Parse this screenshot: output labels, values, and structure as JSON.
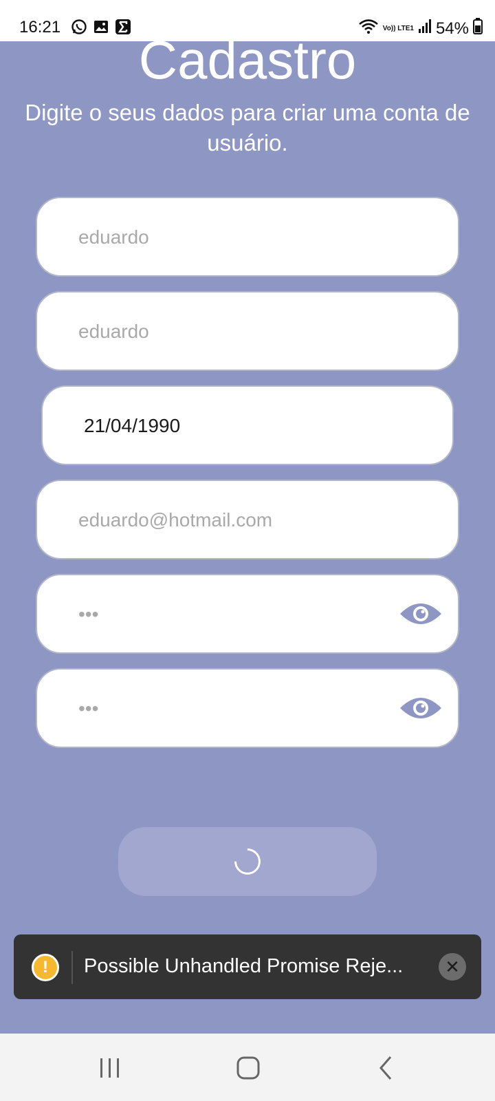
{
  "status_bar": {
    "time": "16:21",
    "left_icons": [
      "whatsapp-icon",
      "gallery-icon",
      "sigma-icon"
    ],
    "network": "Vo)) LTE1",
    "battery": "54%"
  },
  "page": {
    "title": "Cadastro",
    "subtitle": "Digite o seus dados para criar uma conta de usuário."
  },
  "form": {
    "first_name": {
      "placeholder": "eduardo"
    },
    "last_name": {
      "placeholder": "eduardo"
    },
    "birth_date": {
      "value": "21/04/1990"
    },
    "email": {
      "placeholder": "eduardo@hotmail.com"
    },
    "password": {
      "placeholder": "•••",
      "toggle_icon": "eye-icon"
    },
    "confirm_password": {
      "placeholder": "•••",
      "toggle_icon": "eye-icon"
    },
    "submit": {
      "state": "loading"
    }
  },
  "toast": {
    "message": "Possible Unhandled Promise Reje...",
    "icon": "warning-icon",
    "close_icon": "close-icon"
  },
  "nav_bar": {
    "buttons": [
      "recent-apps-icon",
      "home-icon",
      "back-icon"
    ]
  },
  "colors": {
    "background": "#8e97c3",
    "accent": "#8e97c3",
    "button": "#a2a7cf",
    "toast": "#333333",
    "warning": "#f5b82e"
  }
}
